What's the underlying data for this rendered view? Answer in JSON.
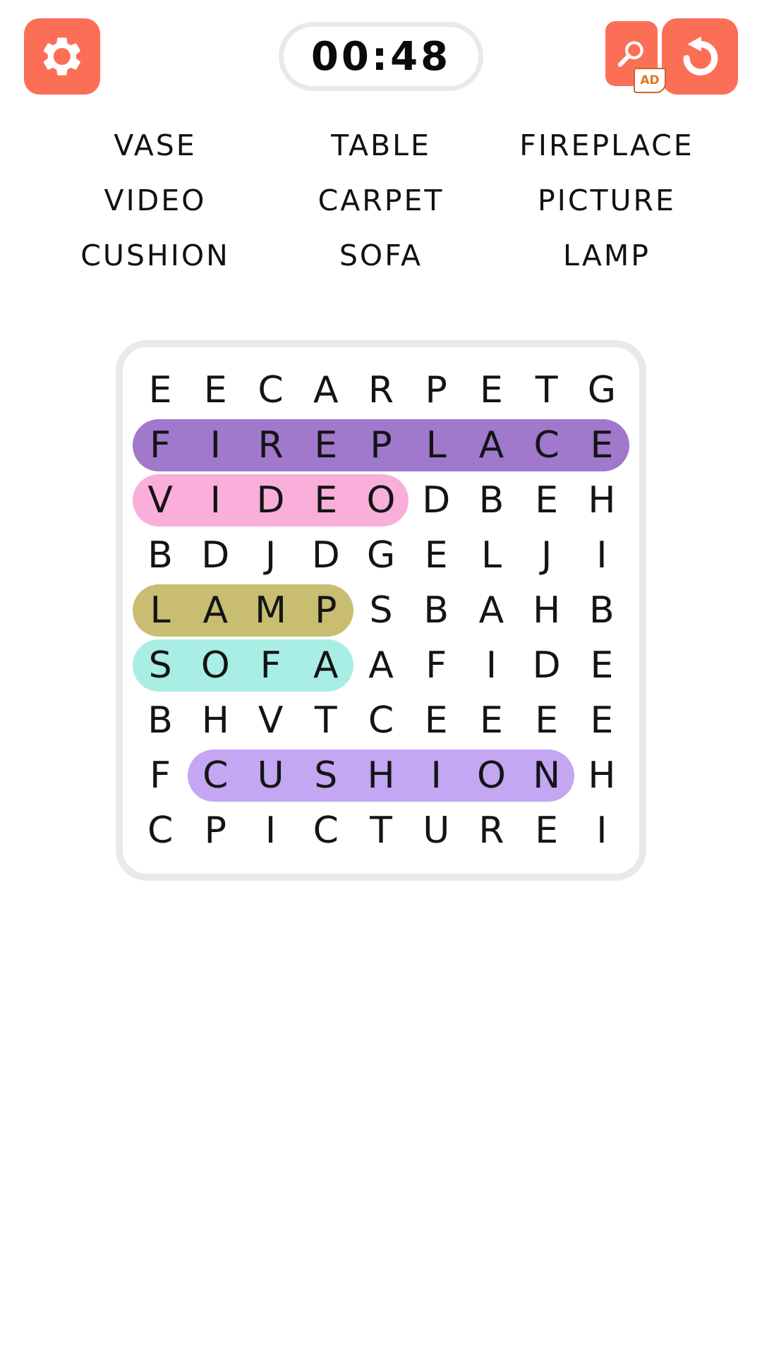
{
  "header": {
    "settings_label": "settings",
    "settings_icon": "gear-icon",
    "timer": "00:48",
    "hint_icon": "magnifier-icon",
    "hint_ad_label": "AD",
    "reset_icon": "undo-arrow-icon"
  },
  "words": [
    {
      "text": "VASE",
      "found": false,
      "color": ""
    },
    {
      "text": "TABLE",
      "found": false,
      "color": ""
    },
    {
      "text": "FIREPLACE",
      "found": true,
      "color": "#a078cc"
    },
    {
      "text": "VIDEO",
      "found": true,
      "color": "#f9afd9"
    },
    {
      "text": "CARPET",
      "found": false,
      "color": ""
    },
    {
      "text": "PICTURE",
      "found": false,
      "color": ""
    },
    {
      "text": "CUSHION",
      "found": true,
      "color": "#c3a7f2"
    },
    {
      "text": "SOFA",
      "found": true,
      "color": "#a9eee4"
    },
    {
      "text": "LAMP",
      "found": true,
      "color": "#c9bd71"
    }
  ],
  "grid": {
    "rows": 9,
    "cols": 9,
    "letters": [
      [
        "E",
        "E",
        "C",
        "A",
        "R",
        "P",
        "E",
        "T",
        "G"
      ],
      [
        "F",
        "I",
        "R",
        "E",
        "P",
        "L",
        "A",
        "C",
        "E"
      ],
      [
        "V",
        "I",
        "D",
        "E",
        "O",
        "D",
        "B",
        "E",
        "H"
      ],
      [
        "B",
        "D",
        "J",
        "D",
        "G",
        "E",
        "L",
        "J",
        "I"
      ],
      [
        "L",
        "A",
        "M",
        "P",
        "S",
        "B",
        "A",
        "H",
        "B"
      ],
      [
        "S",
        "O",
        "F",
        "A",
        "A",
        "F",
        "I",
        "D",
        "E"
      ],
      [
        "B",
        "H",
        "V",
        "T",
        "C",
        "E",
        "E",
        "E",
        "E"
      ],
      [
        "F",
        "C",
        "U",
        "S",
        "H",
        "I",
        "O",
        "N",
        "H"
      ],
      [
        "C",
        "P",
        "I",
        "C",
        "T",
        "U",
        "R",
        "E",
        "I"
      ]
    ],
    "highlights": [
      {
        "word": "FIREPLACE",
        "row": 1,
        "col_start": 0,
        "col_end": 8,
        "color": "#a078cc"
      },
      {
        "word": "VIDEO",
        "row": 2,
        "col_start": 0,
        "col_end": 4,
        "color": "#f9afd9"
      },
      {
        "word": "LAMP",
        "row": 4,
        "col_start": 0,
        "col_end": 3,
        "color": "#c9bd71"
      },
      {
        "word": "SOFA",
        "row": 5,
        "col_start": 0,
        "col_end": 3,
        "color": "#a9eee4"
      },
      {
        "word": "CUSHION",
        "row": 7,
        "col_start": 1,
        "col_end": 7,
        "color": "#c3a7f2"
      }
    ]
  },
  "theme": {
    "accent": "#fb6f56",
    "card_border": "#e9e9e9",
    "letter_color": "#141414"
  }
}
